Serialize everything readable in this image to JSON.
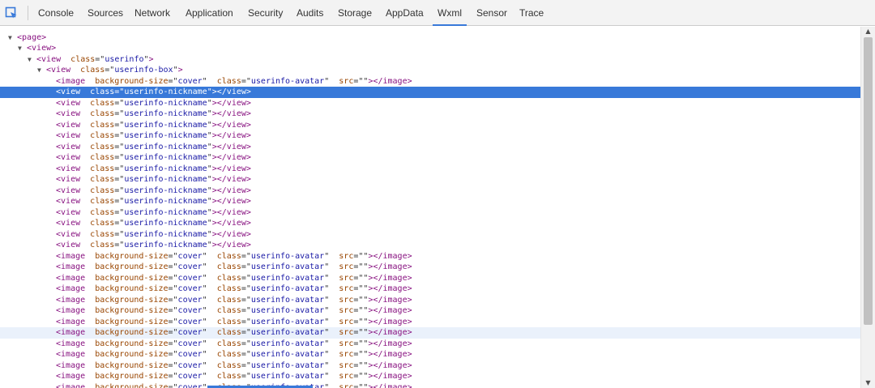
{
  "toolbar": {
    "tabs": [
      {
        "label": "Console",
        "active": false
      },
      {
        "label": "Sources",
        "active": false
      },
      {
        "label": "Network",
        "active": false
      },
      {
        "label": "Application",
        "active": false
      },
      {
        "label": "Security",
        "active": false
      },
      {
        "label": "Audits",
        "active": false
      },
      {
        "label": "Storage",
        "active": false
      },
      {
        "label": "AppData",
        "active": false
      },
      {
        "label": "Wxml",
        "active": true
      },
      {
        "label": "Sensor",
        "active": false
      },
      {
        "label": "Trace",
        "active": false
      }
    ],
    "inspect_icon": "select-element-icon"
  },
  "colors": {
    "accent": "#3879d9",
    "tag": "#881280",
    "attribute": "#994500",
    "value": "#1a1aa6",
    "hover": "#eaf1fb"
  },
  "tree": {
    "rows": [
      {
        "depth": 0,
        "toggle": "▼",
        "tag": "page",
        "attrs": [],
        "close": ""
      },
      {
        "depth": 1,
        "toggle": "▼",
        "tag": "view",
        "attrs": [],
        "close": ""
      },
      {
        "depth": 2,
        "toggle": "▼",
        "tag": "view",
        "attrs": [
          {
            "name": "class",
            "value": "userinfo"
          }
        ],
        "close": ""
      },
      {
        "depth": 3,
        "toggle": "▼",
        "tag": "view",
        "attrs": [
          {
            "name": "class",
            "value": "userinfo-box"
          }
        ],
        "close": ""
      },
      {
        "depth": 4,
        "toggle": "",
        "tag": "image",
        "attrs": [
          {
            "name": "background-size",
            "value": "cover"
          },
          {
            "name": "class",
            "value": "userinfo-avatar"
          },
          {
            "name": "src",
            "value": ""
          }
        ],
        "close": "image"
      },
      {
        "depth": 4,
        "toggle": "",
        "tag": "view",
        "attrs": [
          {
            "name": "class",
            "value": "userinfo-nickname"
          }
        ],
        "close": "view",
        "selected": true
      },
      {
        "depth": 4,
        "toggle": "",
        "tag": "view",
        "attrs": [
          {
            "name": "class",
            "value": "userinfo-nickname"
          }
        ],
        "close": "view"
      },
      {
        "depth": 4,
        "toggle": "",
        "tag": "view",
        "attrs": [
          {
            "name": "class",
            "value": "userinfo-nickname"
          }
        ],
        "close": "view"
      },
      {
        "depth": 4,
        "toggle": "",
        "tag": "view",
        "attrs": [
          {
            "name": "class",
            "value": "userinfo-nickname"
          }
        ],
        "close": "view"
      },
      {
        "depth": 4,
        "toggle": "",
        "tag": "view",
        "attrs": [
          {
            "name": "class",
            "value": "userinfo-nickname"
          }
        ],
        "close": "view"
      },
      {
        "depth": 4,
        "toggle": "",
        "tag": "view",
        "attrs": [
          {
            "name": "class",
            "value": "userinfo-nickname"
          }
        ],
        "close": "view"
      },
      {
        "depth": 4,
        "toggle": "",
        "tag": "view",
        "attrs": [
          {
            "name": "class",
            "value": "userinfo-nickname"
          }
        ],
        "close": "view"
      },
      {
        "depth": 4,
        "toggle": "",
        "tag": "view",
        "attrs": [
          {
            "name": "class",
            "value": "userinfo-nickname"
          }
        ],
        "close": "view"
      },
      {
        "depth": 4,
        "toggle": "",
        "tag": "view",
        "attrs": [
          {
            "name": "class",
            "value": "userinfo-nickname"
          }
        ],
        "close": "view"
      },
      {
        "depth": 4,
        "toggle": "",
        "tag": "view",
        "attrs": [
          {
            "name": "class",
            "value": "userinfo-nickname"
          }
        ],
        "close": "view"
      },
      {
        "depth": 4,
        "toggle": "",
        "tag": "view",
        "attrs": [
          {
            "name": "class",
            "value": "userinfo-nickname"
          }
        ],
        "close": "view"
      },
      {
        "depth": 4,
        "toggle": "",
        "tag": "view",
        "attrs": [
          {
            "name": "class",
            "value": "userinfo-nickname"
          }
        ],
        "close": "view"
      },
      {
        "depth": 4,
        "toggle": "",
        "tag": "view",
        "attrs": [
          {
            "name": "class",
            "value": "userinfo-nickname"
          }
        ],
        "close": "view"
      },
      {
        "depth": 4,
        "toggle": "",
        "tag": "view",
        "attrs": [
          {
            "name": "class",
            "value": "userinfo-nickname"
          }
        ],
        "close": "view"
      },
      {
        "depth": 4,
        "toggle": "",
        "tag": "view",
        "attrs": [
          {
            "name": "class",
            "value": "userinfo-nickname"
          }
        ],
        "close": "view"
      },
      {
        "depth": 4,
        "toggle": "",
        "tag": "image",
        "attrs": [
          {
            "name": "background-size",
            "value": "cover"
          },
          {
            "name": "class",
            "value": "userinfo-avatar"
          },
          {
            "name": "src",
            "value": ""
          }
        ],
        "close": "image"
      },
      {
        "depth": 4,
        "toggle": "",
        "tag": "image",
        "attrs": [
          {
            "name": "background-size",
            "value": "cover"
          },
          {
            "name": "class",
            "value": "userinfo-avatar"
          },
          {
            "name": "src",
            "value": ""
          }
        ],
        "close": "image"
      },
      {
        "depth": 4,
        "toggle": "",
        "tag": "image",
        "attrs": [
          {
            "name": "background-size",
            "value": "cover"
          },
          {
            "name": "class",
            "value": "userinfo-avatar"
          },
          {
            "name": "src",
            "value": ""
          }
        ],
        "close": "image"
      },
      {
        "depth": 4,
        "toggle": "",
        "tag": "image",
        "attrs": [
          {
            "name": "background-size",
            "value": "cover"
          },
          {
            "name": "class",
            "value": "userinfo-avatar"
          },
          {
            "name": "src",
            "value": ""
          }
        ],
        "close": "image"
      },
      {
        "depth": 4,
        "toggle": "",
        "tag": "image",
        "attrs": [
          {
            "name": "background-size",
            "value": "cover"
          },
          {
            "name": "class",
            "value": "userinfo-avatar"
          },
          {
            "name": "src",
            "value": ""
          }
        ],
        "close": "image"
      },
      {
        "depth": 4,
        "toggle": "",
        "tag": "image",
        "attrs": [
          {
            "name": "background-size",
            "value": "cover"
          },
          {
            "name": "class",
            "value": "userinfo-avatar"
          },
          {
            "name": "src",
            "value": ""
          }
        ],
        "close": "image"
      },
      {
        "depth": 4,
        "toggle": "",
        "tag": "image",
        "attrs": [
          {
            "name": "background-size",
            "value": "cover"
          },
          {
            "name": "class",
            "value": "userinfo-avatar"
          },
          {
            "name": "src",
            "value": ""
          }
        ],
        "close": "image"
      },
      {
        "depth": 4,
        "toggle": "",
        "tag": "image",
        "attrs": [
          {
            "name": "background-size",
            "value": "cover"
          },
          {
            "name": "class",
            "value": "userinfo-avatar"
          },
          {
            "name": "src",
            "value": ""
          }
        ],
        "close": "image",
        "hover": true
      },
      {
        "depth": 4,
        "toggle": "",
        "tag": "image",
        "attrs": [
          {
            "name": "background-size",
            "value": "cover"
          },
          {
            "name": "class",
            "value": "userinfo-avatar"
          },
          {
            "name": "src",
            "value": ""
          }
        ],
        "close": "image"
      },
      {
        "depth": 4,
        "toggle": "",
        "tag": "image",
        "attrs": [
          {
            "name": "background-size",
            "value": "cover"
          },
          {
            "name": "class",
            "value": "userinfo-avatar"
          },
          {
            "name": "src",
            "value": ""
          }
        ],
        "close": "image"
      },
      {
        "depth": 4,
        "toggle": "",
        "tag": "image",
        "attrs": [
          {
            "name": "background-size",
            "value": "cover"
          },
          {
            "name": "class",
            "value": "userinfo-avatar"
          },
          {
            "name": "src",
            "value": ""
          }
        ],
        "close": "image"
      },
      {
        "depth": 4,
        "toggle": "",
        "tag": "image",
        "attrs": [
          {
            "name": "background-size",
            "value": "cover"
          },
          {
            "name": "class",
            "value": "userinfo-avatar"
          },
          {
            "name": "src",
            "value": ""
          }
        ],
        "close": "image"
      },
      {
        "depth": 4,
        "toggle": "",
        "tag": "image",
        "attrs": [
          {
            "name": "background-size",
            "value": "cover"
          },
          {
            "name": "class",
            "value": "userinfo-avatar"
          },
          {
            "name": "src",
            "value": ""
          }
        ],
        "close": "image"
      }
    ]
  },
  "scrollbar": {
    "up_icon": "scroll-up-icon",
    "down_icon": "scroll-down-icon"
  }
}
